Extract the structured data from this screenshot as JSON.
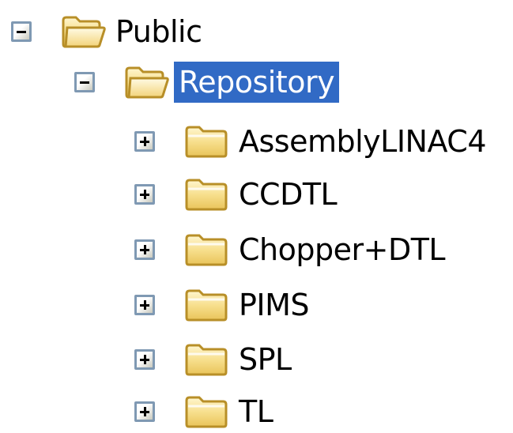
{
  "tree": {
    "root": {
      "label": "Public",
      "expanded": true,
      "icon": "open-folder-icon"
    },
    "repository": {
      "label": "Repository",
      "expanded": true,
      "selected": true,
      "icon": "open-folder-icon"
    },
    "children": [
      {
        "label": "AssemblyLINAC4",
        "expanded": false,
        "icon": "folder-icon"
      },
      {
        "label": "CCDTL",
        "expanded": false,
        "icon": "folder-icon"
      },
      {
        "label": "Chopper+DTL",
        "expanded": false,
        "icon": "folder-icon"
      },
      {
        "label": "PIMS",
        "expanded": false,
        "icon": "folder-icon"
      },
      {
        "label": "SPL",
        "expanded": false,
        "icon": "folder-icon"
      },
      {
        "label": "TL",
        "expanded": false,
        "icon": "folder-icon"
      }
    ]
  },
  "colors": {
    "selection": "#316ac5",
    "selection_text": "#ffffff",
    "toggle_border": "#7f99b3",
    "folder_fill": "#f5d97a",
    "folder_outline": "#b88f28"
  }
}
